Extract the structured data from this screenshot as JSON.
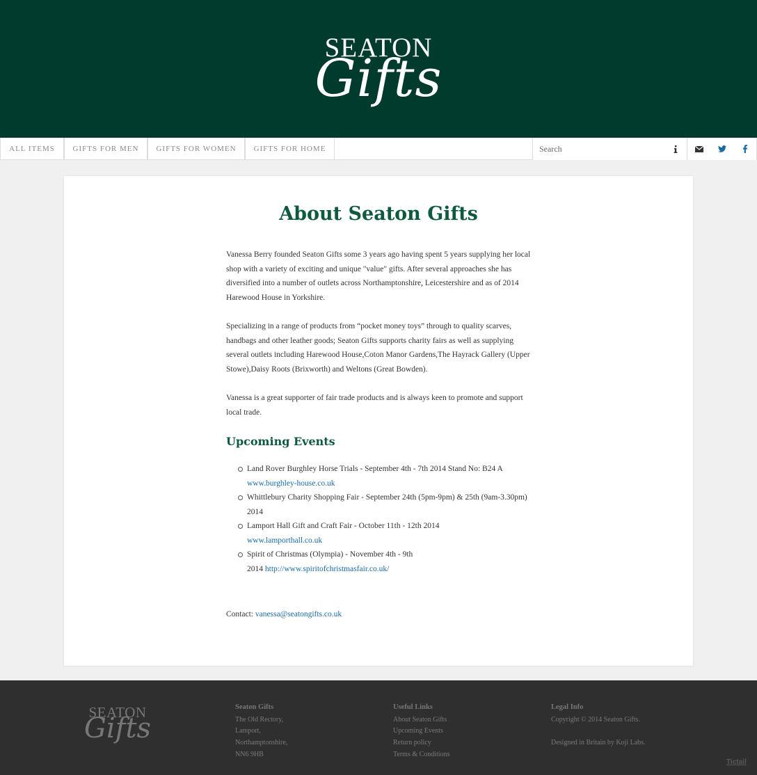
{
  "brand": {
    "logo_line1": "SEATON",
    "logo_line2": "Gifts"
  },
  "nav": {
    "items": [
      {
        "label": "ALL ITEMS"
      },
      {
        "label": "GIFTS FOR MEN"
      },
      {
        "label": "GIFTS FOR WOMEN"
      },
      {
        "label": "GIFTS FOR HOME"
      }
    ],
    "search_placeholder": "Search",
    "icons": [
      "info-icon",
      "envelope-icon",
      "twitter-icon",
      "facebook-icon"
    ]
  },
  "main": {
    "title": "About Seaton Gifts",
    "paragraphs": [
      "Vanessa Berry founded Seaton Gifts some 3 years ago having spent 5 years supplying her local shop with a variety of exciting and unique \"value\" gifts. After several approaches she has diversified into a number of outlets across Northamptonshire, Leicestershire and as of 2014 Harewood House in Yorkshire.",
      "Specializing in a range of products from “pocket money toys” through to quality scarves, handbags and other leather goods; Seaton Gifts supports charity fairs as well as supplying several outlets including Harewood House,Coton Manor Gardens,The Hayrack Gallery (Upper Stowe),Daisy Roots (Brixworth) and Weltons (Great Bowden).",
      "Vanessa is a great supporter of fair trade products and is always keen to promote and support local trade."
    ],
    "events_heading": "Upcoming Events",
    "events": [
      {
        "text": "Land Rover Burghley Horse Trials - September 4th - 7th 2014 Stand No: B24 A ",
        "link": "www.burghley-house.co.uk"
      },
      {
        "text": "Whittlebury Charity Shopping Fair - September 24th (5pm-9pm) & 25th (9am-3.30pm) 2014",
        "link": ""
      },
      {
        "text": "Lamport Hall Gift and Craft  Fair - October 11th - 12th 2014 ",
        "link": "www.lamporthall.co.uk"
      },
      {
        "text": "Spirit of Christmas (Olympia) - November 4th - 9th 2014 ",
        "link": "http://www.spiritofchristmasfair.co.uk/"
      }
    ],
    "contact_label": "Contact: ",
    "contact_email": "vanessa@seatongifts.co.uk"
  },
  "footer": {
    "logo_line1": "SEATON",
    "logo_line2": "Gifts",
    "col1": {
      "heading": "Seaton Gifts",
      "lines": [
        "The Old Rectory,",
        "Lamport,",
        "Northamptonshire,",
        "NN6 9HB"
      ]
    },
    "col2": {
      "heading": "Useful Links",
      "links": [
        "About Seaton Gifts",
        "Upcoming Events",
        "Return policy",
        "Terms & Conditions"
      ]
    },
    "col3": {
      "heading": "Legal Info",
      "copyright": "Copyright © 2014 Seaton Gifts.",
      "designed": "Designed in Britain by Koji Labs."
    },
    "powered": "Tictail"
  }
}
